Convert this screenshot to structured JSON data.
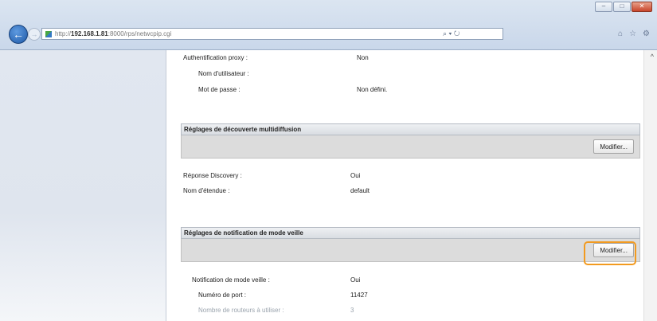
{
  "browser": {
    "url_prefix": "http://",
    "url_host": "192.168.1.81",
    "url_rest": ":8000/rps/netwcpip.cgi",
    "search_glyph": "⌕ ▾ ↻",
    "window_buttons": [
      "–",
      "□",
      "✕"
    ],
    "tool_icons": [
      "⌂",
      "☆",
      "⚙"
    ]
  },
  "proxy": {
    "auth_label": "Authentification proxy :",
    "auth_value": "Non",
    "user_label": "Nom d'utilisateur :",
    "pass_label": "Mot de passe :",
    "pass_value": "Non défini."
  },
  "multicast": {
    "title": "Réglages de découverte multidiffusion",
    "button": "Modifier...",
    "response_label": "Réponse Discovery :",
    "response_value": "Oui",
    "scope_label": "Nom d'étendue :",
    "scope_value": "default"
  },
  "sleep": {
    "title": "Réglages de notification de mode veille",
    "button": "Modifier...",
    "notif_label": "Notification de mode veille :",
    "notif_value": "Oui",
    "port_label": "Numéro de port :",
    "port_value": "11427",
    "routers_label": "Nombre de routeurs à utiliser :",
    "routers_value": "3"
  },
  "colors": {
    "highlight": "#f29a1f",
    "chrome": "#c9d7ea"
  }
}
